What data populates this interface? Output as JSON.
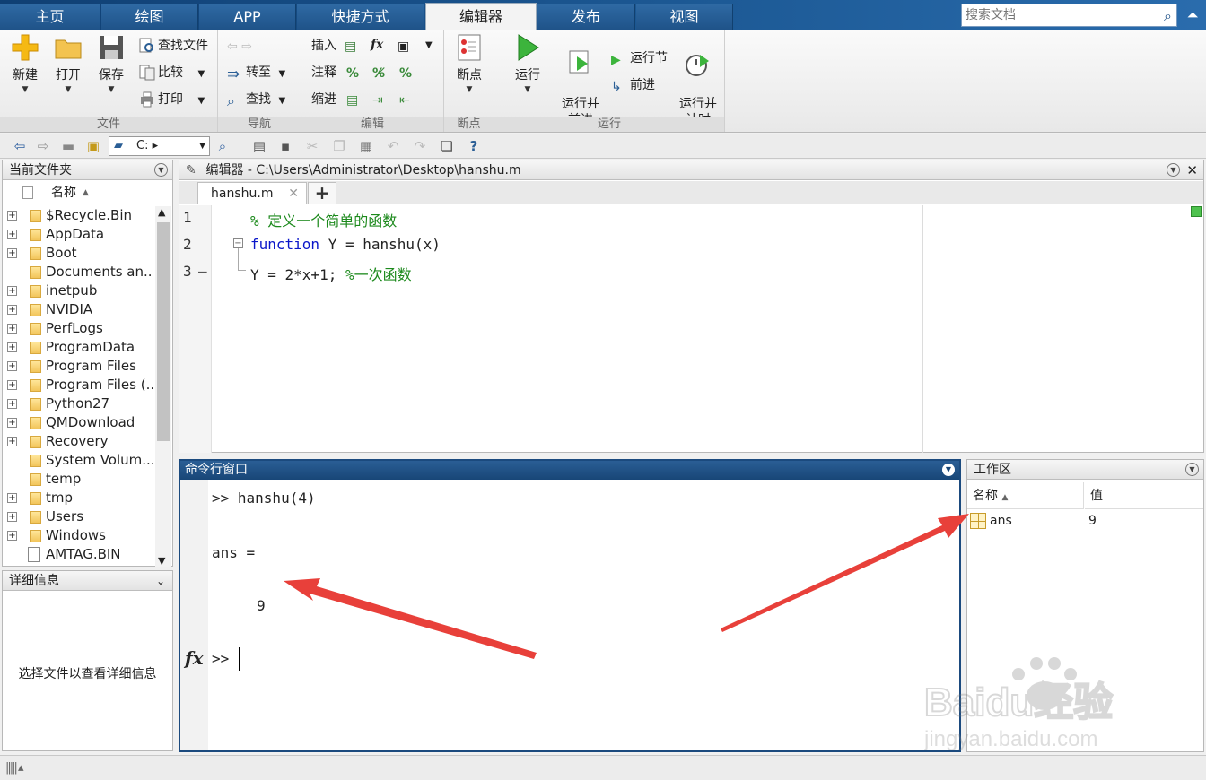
{
  "tabs": [
    {
      "label": "主页",
      "active": false
    },
    {
      "label": "绘图",
      "active": false
    },
    {
      "label": "APP",
      "active": false
    },
    {
      "label": "快捷方式",
      "active": false
    },
    {
      "label": "编辑器",
      "active": true
    },
    {
      "label": "发布",
      "active": false
    },
    {
      "label": "视图",
      "active": false
    }
  ],
  "search": {
    "placeholder": "搜索文档"
  },
  "ribbon": {
    "file": {
      "label": "文件",
      "new": "新建",
      "open": "打开",
      "save": "保存",
      "find_files": "查找文件",
      "compare": "比较",
      "print": "打印"
    },
    "nav": {
      "label": "导航",
      "goto": "转至",
      "find": "查找"
    },
    "edit": {
      "label": "编辑",
      "insert": "插入",
      "comment": "注释",
      "indent": "缩进",
      "fx": "fx"
    },
    "breakpoints": {
      "label": "断点",
      "breakpoint": "断点"
    },
    "run": {
      "label": "运行",
      "run": "运行",
      "run_advance": "运行并\n前进",
      "run_section": "运行节",
      "advance": "前进",
      "run_time": "运行并\n计时"
    }
  },
  "quickbar": {
    "path": "C:",
    "path_arrow": "▸"
  },
  "current_folder": {
    "title": "当前文件夹",
    "column": "名称",
    "items": [
      {
        "name": "$Recycle.Bin",
        "type": "folder"
      },
      {
        "name": "AppData",
        "type": "folder"
      },
      {
        "name": "Boot",
        "type": "folder"
      },
      {
        "name": "Documents an...",
        "type": "folder-noexp"
      },
      {
        "name": "inetpub",
        "type": "folder"
      },
      {
        "name": "NVIDIA",
        "type": "folder"
      },
      {
        "name": "PerfLogs",
        "type": "folder"
      },
      {
        "name": "ProgramData",
        "type": "folder"
      },
      {
        "name": "Program Files",
        "type": "folder"
      },
      {
        "name": "Program Files (...",
        "type": "folder"
      },
      {
        "name": "Python27",
        "type": "folder"
      },
      {
        "name": "QMDownload",
        "type": "folder"
      },
      {
        "name": "Recovery",
        "type": "folder"
      },
      {
        "name": "System Volum...",
        "type": "folder-noexp"
      },
      {
        "name": "temp",
        "type": "folder-noexp"
      },
      {
        "name": "tmp",
        "type": "folder"
      },
      {
        "name": "Users",
        "type": "folder"
      },
      {
        "name": "Windows",
        "type": "folder"
      },
      {
        "name": "AMTAG.BIN",
        "type": "file"
      }
    ]
  },
  "details": {
    "title": "详细信息",
    "message": "选择文件以查看详细信息"
  },
  "editor": {
    "title": "编辑器 - C:\\Users\\Administrator\\Desktop\\hanshu.m",
    "tab": "hanshu.m",
    "lines": [
      {
        "num": "1",
        "comment": "% 定义一个简单的函数"
      },
      {
        "num": "2",
        "keyword": "function",
        "code": " Y = hanshu(x)"
      },
      {
        "num": "3",
        "marker": "—",
        "code": "Y = 2*x+1; ",
        "comment": "%一次函数"
      }
    ]
  },
  "command": {
    "title": "命令行窗口",
    "lines": [
      ">> hanshu(4)",
      "ans =",
      "9"
    ],
    "prompt": ">>",
    "fx": "fx"
  },
  "workspace": {
    "title": "工作区",
    "col_name": "名称",
    "col_value": "值",
    "rows": [
      {
        "name": "ans",
        "value": "9"
      }
    ]
  },
  "watermark": {
    "brand": "Baidu经验",
    "url": "jingyan.baidu.com"
  },
  "colors": {
    "accent": "#1b4a7e",
    "keyword": "#0b17c9",
    "comment": "#1d8a1d",
    "arrow": "#e8403a"
  }
}
